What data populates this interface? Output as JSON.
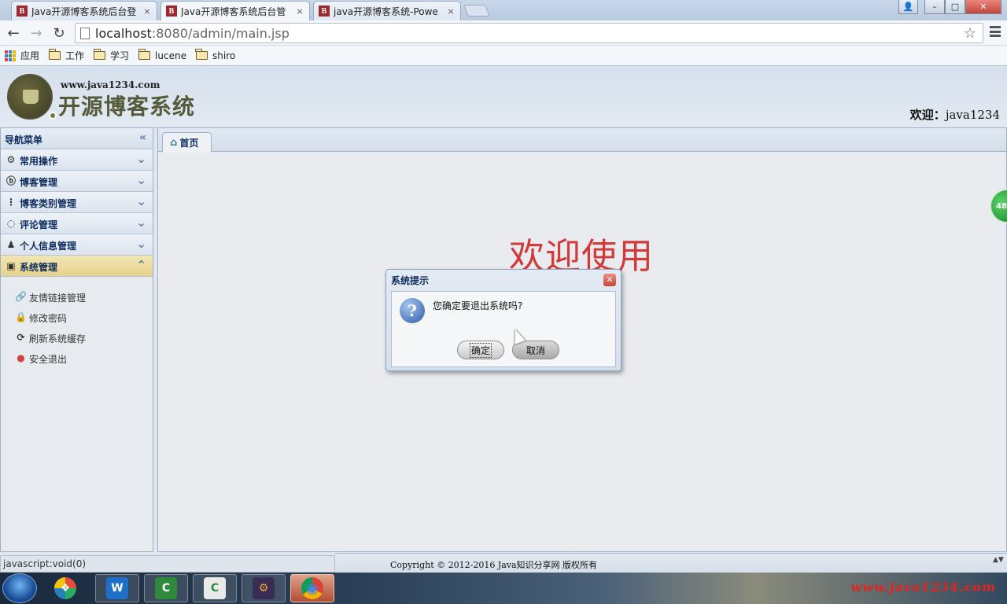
{
  "browser": {
    "tabs": [
      {
        "favicon": "B",
        "label": "Java开源博客系统后台登",
        "close": "×"
      },
      {
        "favicon": "B",
        "label": "Java开源博客系统后台管",
        "close": "×"
      },
      {
        "favicon": "B",
        "label": "java开源博客系统-Powe",
        "close": "×"
      }
    ],
    "window_controls": {
      "user": "👤",
      "minimize": "–",
      "maximize": "□",
      "close": "✕"
    },
    "nav": {
      "back": "←",
      "forward": "→",
      "reload": "↻"
    },
    "address": {
      "host": "localhost",
      "path": ":8080/admin/main.jsp",
      "star": "☆"
    },
    "bookmarks": [
      {
        "icon": "apps-grid-icon",
        "label": "应用"
      },
      {
        "icon": "folder-icon",
        "label": "工作"
      },
      {
        "icon": "folder-icon",
        "label": "学习"
      },
      {
        "icon": "folder-icon",
        "label": "lucene"
      },
      {
        "icon": "folder-icon",
        "label": "shiro"
      }
    ]
  },
  "header": {
    "site_url": "www.java1234.com",
    "site_title": "开源博客系统",
    "welcome_label": "欢迎：",
    "username": "java1234"
  },
  "nav": {
    "title": "导航菜单",
    "collapse_glyph": "«",
    "items": [
      {
        "icon": "gear-icon",
        "glyph": "⚙",
        "label": "常用操作",
        "chev": "⌄"
      },
      {
        "icon": "blog-icon",
        "glyph": "ⓑ",
        "label": "博客管理",
        "chev": "⌄"
      },
      {
        "icon": "tree-icon",
        "glyph": "⋮",
        "label": "博客类别管理",
        "chev": "⌄"
      },
      {
        "icon": "comment-icon",
        "glyph": "◌",
        "label": "评论管理",
        "chev": "⌄"
      },
      {
        "icon": "user-icon",
        "glyph": "♟",
        "label": "个人信息管理",
        "chev": "⌄"
      },
      {
        "icon": "system-icon",
        "glyph": "▣",
        "label": "系统管理",
        "chev": "⌃"
      }
    ],
    "submenu": [
      {
        "icon": "link-icon",
        "glyph": "🔗",
        "label": "友情链接管理"
      },
      {
        "icon": "lock-icon",
        "glyph": "🔒",
        "label": "修改密码"
      },
      {
        "icon": "refresh-icon",
        "glyph": "⟳",
        "label": "刷新系统缓存"
      },
      {
        "icon": "exit-icon",
        "glyph": "●",
        "label": "安全退出"
      }
    ]
  },
  "main": {
    "home_tab": {
      "icon": "home-icon",
      "glyph": "⌂",
      "label": "首页"
    },
    "welcome_text": "欢迎使用",
    "side_badge": "48"
  },
  "dialog": {
    "title": "系统提示",
    "close": "✕",
    "icon": "question-icon",
    "icon_glyph": "?",
    "message": "您确定要退出系统吗?",
    "ok_label": "确定",
    "cancel_label": "取消"
  },
  "status": {
    "url": "javascript:void(0)",
    "copyright": "Copyright © 2012-2016 Java知识分享网 版权所有",
    "scroll": "▲▼"
  },
  "taskbar": {
    "apps": [
      {
        "icon": "start-orb-icon"
      },
      {
        "icon": "window-switcher-icon",
        "glyph": "❖"
      },
      {
        "icon": "wps-writer-icon",
        "glyph": "W"
      },
      {
        "icon": "camtasia-icon",
        "glyph": "C"
      },
      {
        "icon": "camtasia-player-icon",
        "glyph": "C"
      },
      {
        "icon": "javaee-ide-icon",
        "glyph": "⚙"
      },
      {
        "icon": "chrome-icon",
        "glyph": "◉"
      }
    ],
    "watermark": "www.java1234.com"
  },
  "colors": {
    "accent_red": "#d23a3a",
    "selected_menu": "#e5d28c",
    "frame_blue": "#9fb1c8"
  }
}
